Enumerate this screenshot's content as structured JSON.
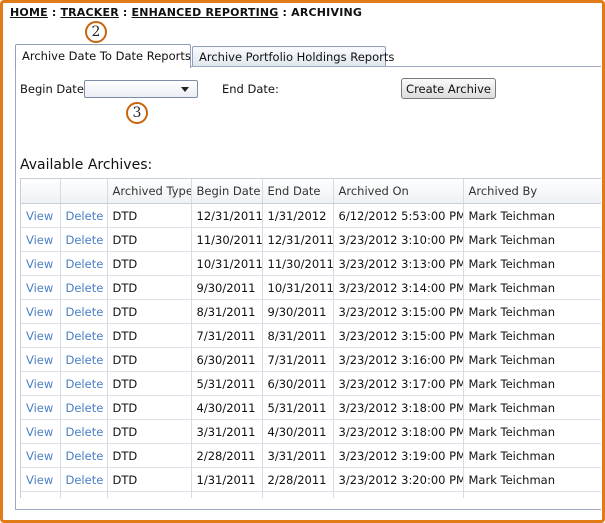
{
  "breadcrumb": {
    "items": [
      "HOME",
      "TRACKER",
      "ENHANCED REPORTING"
    ],
    "current": "ARCHIVING",
    "separator": ":"
  },
  "markers": [
    "2",
    "3"
  ],
  "tabs": [
    {
      "label": "Archive Date To Date Reports",
      "active": true
    },
    {
      "label": "Archive Portfolio Holdings Reports",
      "active": false
    }
  ],
  "form": {
    "begin_date_label": "Begin Date:",
    "begin_date_value": "",
    "end_date_label": "End Date:",
    "create_button": "Create Archive"
  },
  "archives": {
    "title": "Available Archives:",
    "columns": [
      "",
      "",
      "Archived Type",
      "Begin Date",
      "End Date",
      "Archived On",
      "Archived By"
    ],
    "view_label": "View",
    "delete_label": "Delete",
    "rows": [
      {
        "type": "DTD",
        "begin": "12/31/2011",
        "end": "1/31/2012",
        "archived_on": "6/12/2012 5:53:00 PM",
        "by": "Mark Teichman"
      },
      {
        "type": "DTD",
        "begin": "11/30/2011",
        "end": "12/31/2011",
        "archived_on": "3/23/2012 3:10:00 PM",
        "by": "Mark Teichman"
      },
      {
        "type": "DTD",
        "begin": "10/31/2011",
        "end": "11/30/2011",
        "archived_on": "3/23/2012 3:13:00 PM",
        "by": "Mark Teichman"
      },
      {
        "type": "DTD",
        "begin": "9/30/2011",
        "end": "10/31/2011",
        "archived_on": "3/23/2012 3:14:00 PM",
        "by": "Mark Teichman"
      },
      {
        "type": "DTD",
        "begin": "8/31/2011",
        "end": "9/30/2011",
        "archived_on": "3/23/2012 3:15:00 PM",
        "by": "Mark Teichman"
      },
      {
        "type": "DTD",
        "begin": "7/31/2011",
        "end": "8/31/2011",
        "archived_on": "3/23/2012 3:15:00 PM",
        "by": "Mark Teichman"
      },
      {
        "type": "DTD",
        "begin": "6/30/2011",
        "end": "7/31/2011",
        "archived_on": "3/23/2012 3:16:00 PM",
        "by": "Mark Teichman"
      },
      {
        "type": "DTD",
        "begin": "5/31/2011",
        "end": "6/30/2011",
        "archived_on": "3/23/2012 3:17:00 PM",
        "by": "Mark Teichman"
      },
      {
        "type": "DTD",
        "begin": "4/30/2011",
        "end": "5/31/2011",
        "archived_on": "3/23/2012 3:18:00 PM",
        "by": "Mark Teichman"
      },
      {
        "type": "DTD",
        "begin": "3/31/2011",
        "end": "4/30/2011",
        "archived_on": "3/23/2012 3:18:00 PM",
        "by": "Mark Teichman"
      },
      {
        "type": "DTD",
        "begin": "2/28/2011",
        "end": "3/31/2011",
        "archived_on": "3/23/2012 3:19:00 PM",
        "by": "Mark Teichman"
      },
      {
        "type": "DTD",
        "begin": "1/31/2011",
        "end": "2/28/2011",
        "archived_on": "3/23/2012 3:20:00 PM",
        "by": "Mark Teichman"
      }
    ]
  },
  "colors": {
    "frame": "#e07b18",
    "link": "#4a7fc4",
    "marker": "#c8640a"
  }
}
